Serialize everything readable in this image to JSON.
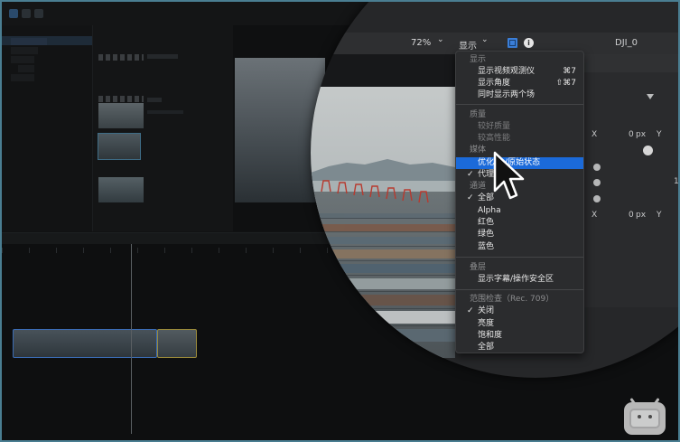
{
  "viewer_toolbar": {
    "zoom": "72%",
    "zoom_chevron": "⌄",
    "view_menu": "显示",
    "view_chevron": "⌄",
    "clip_name": "DJI_0"
  },
  "inspector": {
    "x_label": "X",
    "y_label": "Y",
    "x1_value": "0",
    "x1_unit": "px",
    "x2_value": "0",
    "x2_unit": "px",
    "one_value": "1"
  },
  "menu": {
    "section_view": "显示",
    "show_scopes": "显示视频观测仪",
    "show_scopes_shortcut": "⌘7",
    "show_angles": "显示角度",
    "show_angles_shortcut": "⇧⌘7",
    "show_both_fields": "同时显示两个场",
    "section_quality": "质量",
    "better_quality": "较好质量",
    "better_performance": "较高性能",
    "section_media": "媒体",
    "optimized_original": "优化/小/原始状态",
    "proxy": "代理",
    "section_channels": "通道",
    "all": "全部",
    "alpha": "Alpha",
    "red": "红色",
    "green": "绿色",
    "blue": "蓝色",
    "section_overlays": "叠层",
    "show_title_safe": "显示字幕/操作安全区",
    "section_range_check": "范围检查（Rec. 709）",
    "off": "关闭",
    "luma": "亮度",
    "saturation": "饱和度",
    "all_partial": "全部",
    "check": "✓"
  },
  "colors": {
    "menu_bg": "#2b2c2e",
    "highlight": "#1b6ad9",
    "header_gray": "#8b8c8e"
  },
  "icons": [
    "cursor-arrow-icon",
    "info-icon",
    "view-grid-icon",
    "bilibili-logo-icon"
  ]
}
